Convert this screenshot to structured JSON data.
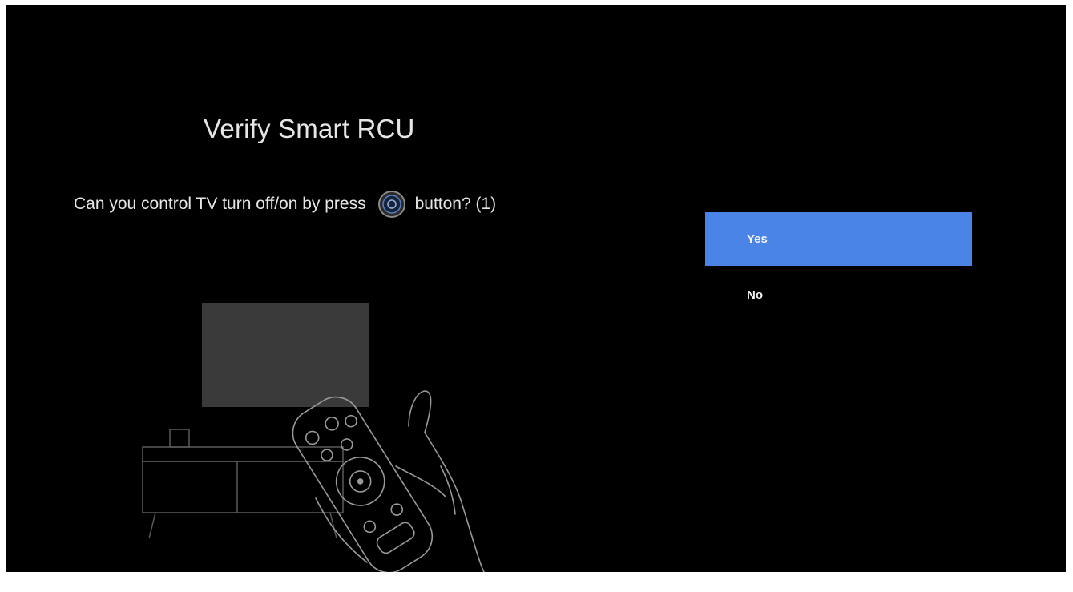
{
  "dialog": {
    "title": "Verify Smart RCU",
    "question_before_icon": "Can you control TV turn off/on by press",
    "question_icon": "power-button-icon",
    "question_after_icon": "button? (1)"
  },
  "options": [
    {
      "label": "Yes",
      "selected": true
    },
    {
      "label": "No",
      "selected": false
    }
  ],
  "colors": {
    "background": "#000000",
    "selected_option": "#4a84e6",
    "text": "#e6e6e6",
    "illustration_line": "#6f6f6f",
    "tv_screen": "#3a3a3a"
  },
  "illustration": "tv-with-remote-icon"
}
